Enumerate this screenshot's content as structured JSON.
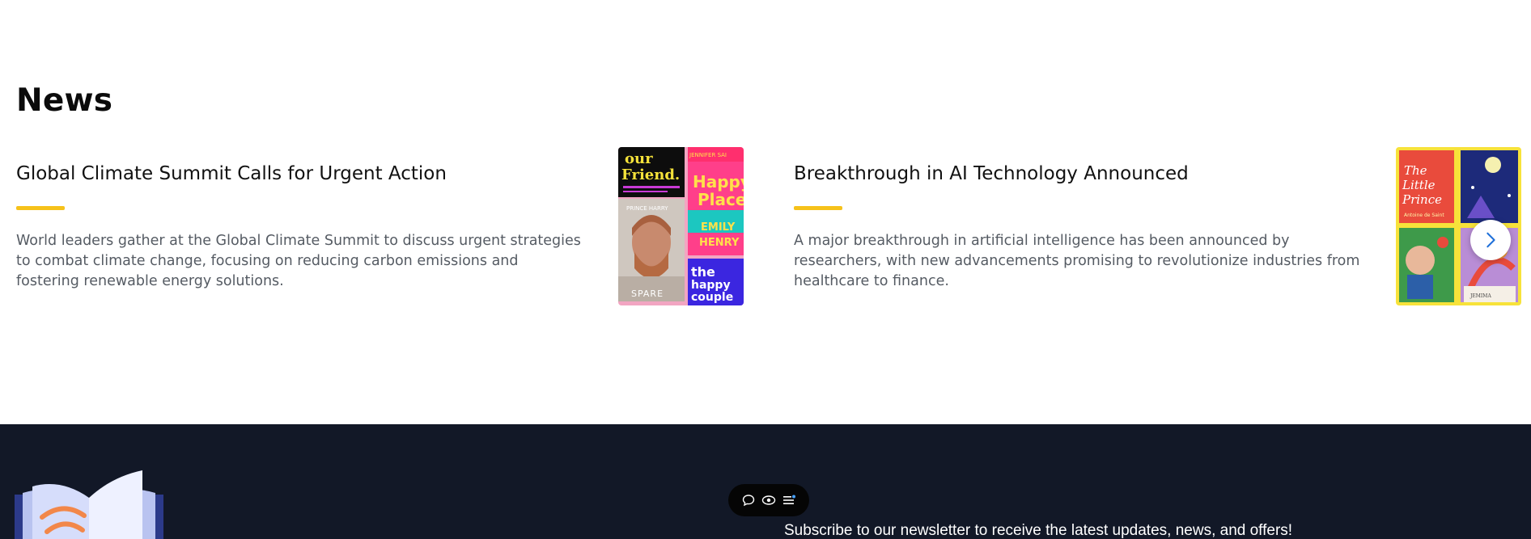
{
  "news": {
    "heading": "News",
    "articles": [
      {
        "title": "Global Climate Summit Calls for Urgent Action",
        "description": "World leaders gather at the Global Climate Summit to discuss urgent strategies to combat climate change, focusing on reducing carbon emissions and fostering renewable energy solutions.",
        "image_alt": "book-covers-collage"
      },
      {
        "title": "Breakthrough in AI Technology Announced",
        "description": "A major breakthrough in artificial intelligence has been announced by researchers, with new advancements promising to revolutionize industries from healthcare to finance.",
        "image_alt": "book-covers-collage"
      }
    ],
    "next_icon": "chevron-right-icon"
  },
  "footer": {
    "newsletter_text": "Subscribe to our newsletter to receive the latest updates, news, and offers!",
    "logo_icon": "open-book-icon"
  },
  "toolbar": {
    "icons": [
      "comment-icon",
      "eye-icon",
      "menu-icon"
    ]
  },
  "colors": {
    "accent": "#f6c21a",
    "footer_bg": "#121827",
    "link_blue": "#1e6fd9"
  }
}
